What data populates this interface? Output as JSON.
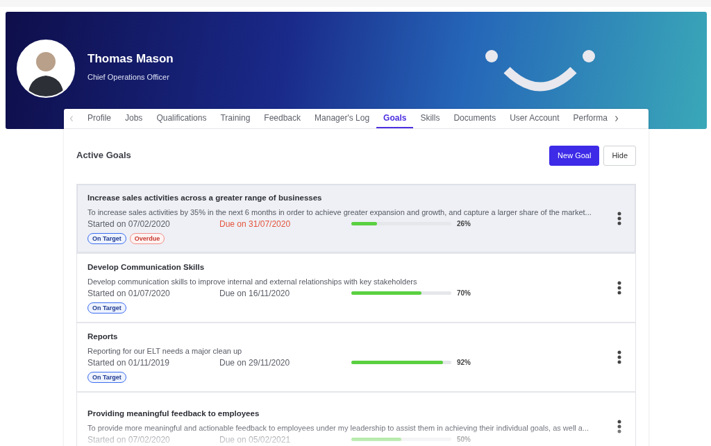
{
  "profile": {
    "name": "Thomas Mason",
    "role": "Chief Operations Officer"
  },
  "tabs": [
    {
      "label": "Profile",
      "selected": false
    },
    {
      "label": "Jobs",
      "selected": false
    },
    {
      "label": "Qualifications",
      "selected": false
    },
    {
      "label": "Training",
      "selected": false
    },
    {
      "label": "Feedback",
      "selected": false
    },
    {
      "label": "Manager's Log",
      "selected": false
    },
    {
      "label": "Goals",
      "selected": true
    },
    {
      "label": "Skills",
      "selected": false
    },
    {
      "label": "Documents",
      "selected": false
    },
    {
      "label": "User Account",
      "selected": false
    },
    {
      "label": "Performa",
      "selected": false
    }
  ],
  "section": {
    "title": "Active Goals",
    "buttons": [
      {
        "label": "New Goal",
        "kind": "primary"
      },
      {
        "label": "Hide",
        "kind": "secondary"
      }
    ]
  },
  "goals": [
    {
      "title": "Increase sales activities across a greater range of businesses",
      "description": "To increase sales activities by 35% in the next 6 months in order to achieve greater expansion and growth, and capture a larger share of the market...",
      "started": "Started on 07/02/2020",
      "due": "Due on 31/07/2020",
      "overdue": true,
      "level": 0.26,
      "percent": "26%",
      "selected": true,
      "tags": [
        {
          "label": "On Target",
          "kind": "on_target"
        },
        {
          "label": "Overdue",
          "kind": "overdue"
        }
      ]
    },
    {
      "title": "Develop Communication Skills",
      "description": "Develop communication skills to improve internal and external relationships with key stakeholders",
      "started": "Started on 01/07/2020",
      "due": "Due on 16/11/2020",
      "overdue": false,
      "level": 0.7,
      "percent": "70%",
      "selected": false,
      "tags": [
        {
          "label": "On Target",
          "kind": "on_target"
        }
      ]
    },
    {
      "title": "Reports",
      "description": "Reporting for our ELT needs a major clean up",
      "started": "Started on 01/11/2019",
      "due": "Due on 29/11/2020",
      "overdue": false,
      "level": 0.92,
      "percent": "92%",
      "selected": false,
      "tags": [
        {
          "label": "On Target",
          "kind": "on_target"
        }
      ]
    },
    {
      "title": "Providing meaningful feedback to employees",
      "description": "To provide more meaningful and actionable feedback to employees under my leadership to assist them in achieving their individual goals, as well a...",
      "started": "Started on 07/02/2020",
      "due": "Due on 05/02/2021",
      "overdue": false,
      "level": 0.5,
      "percent": "50%",
      "selected": false
    }
  ]
}
